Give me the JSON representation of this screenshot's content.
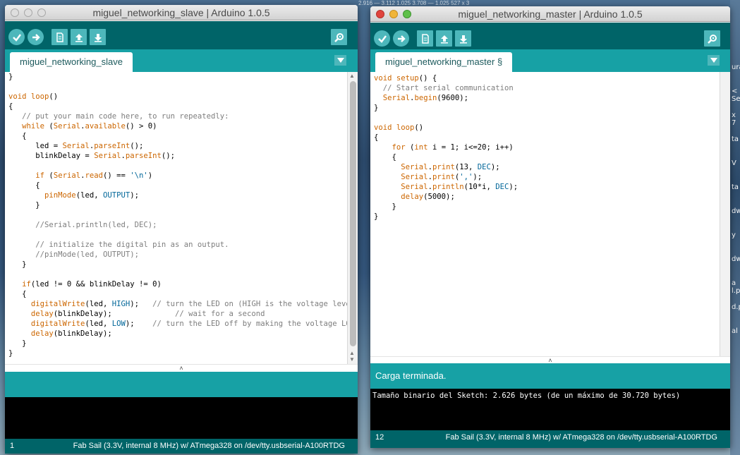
{
  "desktop": {
    "top_text": "2.916 — 3.112                 1.025     3.708 — 1.025          527 x 3",
    "side_text": [
      "ura",
      "< Se",
      "x 7",
      "ta",
      "V",
      "ta",
      "dw",
      "y",
      "dw",
      "a l.p",
      "d.p",
      "al"
    ]
  },
  "slave_window": {
    "title": "miguel_networking_slave | Arduino 1.0.5",
    "tab_label": "miguel_networking_slave",
    "code_lines": [
      [
        [
          "",
          "}"
        ]
      ],
      [
        [
          "",
          ""
        ]
      ],
      [
        [
          "kw",
          "void"
        ],
        [
          "",
          " "
        ],
        [
          "kw",
          "loop"
        ],
        [
          "",
          "()"
        ]
      ],
      [
        [
          "",
          "{"
        ]
      ],
      [
        [
          "",
          "   "
        ],
        [
          "cm",
          "// put your main code here, to run repeatedly:"
        ]
      ],
      [
        [
          "",
          "   "
        ],
        [
          "kw",
          "while"
        ],
        [
          "",
          " ("
        ],
        [
          "kw",
          "Serial"
        ],
        [
          "",
          "."
        ],
        [
          "kw",
          "available"
        ],
        [
          "",
          "() > 0)"
        ]
      ],
      [
        [
          "",
          "   {"
        ]
      ],
      [
        [
          "",
          "      led = "
        ],
        [
          "kw",
          "Serial"
        ],
        [
          "",
          "."
        ],
        [
          "kw",
          "parseInt"
        ],
        [
          "",
          "();"
        ]
      ],
      [
        [
          "",
          "      blinkDelay = "
        ],
        [
          "kw",
          "Serial"
        ],
        [
          "",
          "."
        ],
        [
          "kw",
          "parseInt"
        ],
        [
          "",
          "();"
        ]
      ],
      [
        [
          "",
          ""
        ]
      ],
      [
        [
          "",
          "      "
        ],
        [
          "kw",
          "if"
        ],
        [
          "",
          " ("
        ],
        [
          "kw",
          "Serial"
        ],
        [
          "",
          "."
        ],
        [
          "kw",
          "read"
        ],
        [
          "",
          "() == "
        ],
        [
          "st",
          "'\\n'"
        ],
        [
          "",
          ")"
        ]
      ],
      [
        [
          "",
          "      {"
        ]
      ],
      [
        [
          "",
          "        "
        ],
        [
          "kw",
          "pinMode"
        ],
        [
          "",
          "(led, "
        ],
        [
          "cs",
          "OUTPUT"
        ],
        [
          "",
          ");"
        ]
      ],
      [
        [
          "",
          "      }"
        ]
      ],
      [
        [
          "",
          ""
        ]
      ],
      [
        [
          "",
          "      "
        ],
        [
          "cm",
          "//Serial.println(led, DEC);"
        ]
      ],
      [
        [
          "",
          ""
        ]
      ],
      [
        [
          "",
          "      "
        ],
        [
          "cm",
          "// initialize the digital pin as an output."
        ]
      ],
      [
        [
          "",
          "      "
        ],
        [
          "cm",
          "//pinMode(led, OUTPUT);"
        ]
      ],
      [
        [
          "",
          "   }"
        ]
      ],
      [
        [
          "",
          ""
        ]
      ],
      [
        [
          "",
          "   "
        ],
        [
          "kw",
          "if"
        ],
        [
          "",
          "(led != 0 && blinkDelay != 0)"
        ]
      ],
      [
        [
          "",
          "   {"
        ]
      ],
      [
        [
          "",
          "     "
        ],
        [
          "kw",
          "digitalWrite"
        ],
        [
          "",
          "(led, "
        ],
        [
          "cs",
          "HIGH"
        ],
        [
          "",
          ");   "
        ],
        [
          "cm",
          "// turn the LED on (HIGH is the voltage level)"
        ]
      ],
      [
        [
          "",
          "     "
        ],
        [
          "kw",
          "delay"
        ],
        [
          "",
          "(blinkDelay);              "
        ],
        [
          "cm",
          "// wait for a second"
        ]
      ],
      [
        [
          "",
          "     "
        ],
        [
          "kw",
          "digitalWrite"
        ],
        [
          "",
          "(led, "
        ],
        [
          "cs",
          "LOW"
        ],
        [
          "",
          ");    "
        ],
        [
          "cm",
          "// turn the LED off by making the voltage LOW"
        ]
      ],
      [
        [
          "",
          "     "
        ],
        [
          "kw",
          "delay"
        ],
        [
          "",
          "(blinkDelay);"
        ]
      ],
      [
        [
          "",
          "   }"
        ]
      ],
      [
        [
          "",
          "}"
        ]
      ]
    ],
    "message": "",
    "console": "",
    "status_line": "1",
    "status_board": "Fab Sail (3.3V, internal 8 MHz) w/ ATmega328 on /dev/tty.usbserial-A100RTDG"
  },
  "master_window": {
    "title": "miguel_networking_master | Arduino 1.0.5",
    "tab_label": "miguel_networking_master §",
    "code_lines": [
      [
        [
          "kw",
          "void"
        ],
        [
          "",
          " "
        ],
        [
          "kw",
          "setup"
        ],
        [
          "",
          "() {"
        ]
      ],
      [
        [
          "",
          "  "
        ],
        [
          "cm",
          "// Start serial communication"
        ]
      ],
      [
        [
          "",
          "  "
        ],
        [
          "kw",
          "Serial"
        ],
        [
          "",
          "."
        ],
        [
          "kw",
          "begin"
        ],
        [
          "",
          "(9600);"
        ]
      ],
      [
        [
          "",
          "}"
        ]
      ],
      [
        [
          "",
          ""
        ]
      ],
      [
        [
          "kw",
          "void"
        ],
        [
          "",
          " "
        ],
        [
          "kw",
          "loop"
        ],
        [
          "",
          "()"
        ]
      ],
      [
        [
          "",
          "{"
        ]
      ],
      [
        [
          "",
          "    "
        ],
        [
          "kw",
          "for"
        ],
        [
          "",
          " ("
        ],
        [
          "kw",
          "int"
        ],
        [
          "",
          " i = 1; i<=20; i++)"
        ]
      ],
      [
        [
          "",
          "    {"
        ]
      ],
      [
        [
          "",
          "      "
        ],
        [
          "kw",
          "Serial"
        ],
        [
          "",
          "."
        ],
        [
          "kw",
          "print"
        ],
        [
          "",
          "(13, "
        ],
        [
          "cs",
          "DEC"
        ],
        [
          "",
          ");"
        ]
      ],
      [
        [
          "",
          "      "
        ],
        [
          "kw",
          "Serial"
        ],
        [
          "",
          "."
        ],
        [
          "kw",
          "print"
        ],
        [
          "",
          "("
        ],
        [
          "st",
          "','"
        ],
        [
          "",
          ");"
        ]
      ],
      [
        [
          "",
          "      "
        ],
        [
          "kw",
          "Serial"
        ],
        [
          "",
          "."
        ],
        [
          "kw",
          "println"
        ],
        [
          "",
          "(10*i, "
        ],
        [
          "cs",
          "DEC"
        ],
        [
          "",
          ");"
        ]
      ],
      [
        [
          "",
          "      "
        ],
        [
          "kw",
          "delay"
        ],
        [
          "",
          "(5000);"
        ]
      ],
      [
        [
          "",
          "    }"
        ]
      ],
      [
        [
          "",
          "}"
        ]
      ]
    ],
    "message": "Carga terminada.",
    "console": "Tamaño binario del Sketch: 2.626 bytes (de un máximo de 30.720 bytes)",
    "status_line": "12",
    "status_board": "Fab Sail (3.3V, internal 8 MHz) w/ ATmega328 on /dev/tty.usbserial-A100RTDG"
  },
  "toolbar_icons": [
    "verify-icon",
    "upload-icon",
    "new-icon",
    "open-icon",
    "save-icon",
    "serial-monitor-icon"
  ],
  "colors": {
    "toolbar": "#006468",
    "tabbar": "#17a1a5",
    "button": "#4db7bb",
    "keyword": "#cc6600",
    "constant": "#006699",
    "comment": "#7e7e7e"
  }
}
